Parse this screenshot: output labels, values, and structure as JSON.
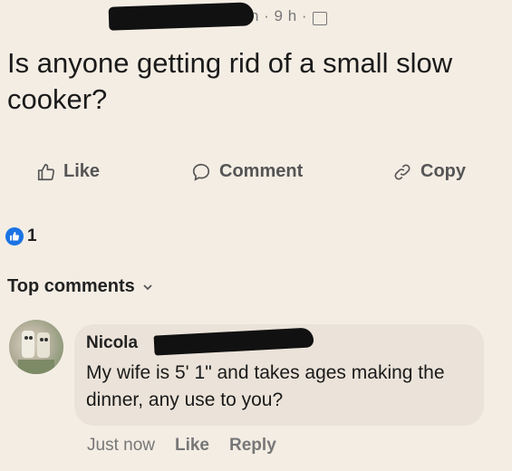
{
  "post": {
    "meta": "h · 9 h ·",
    "text": "Is anyone getting rid of a small slow cooker?"
  },
  "actions": {
    "like": "Like",
    "comment": "Comment",
    "copy": "Copy"
  },
  "reactions": {
    "count": "1",
    "color": "#1b74e4"
  },
  "comments_section": {
    "label": "Top comments"
  },
  "comment": {
    "author": "Nicola",
    "text": "My wife  is 5' 1\" and takes ages making the dinner, any use to you?",
    "time": "Just now",
    "like": "Like",
    "reply": "Reply"
  }
}
